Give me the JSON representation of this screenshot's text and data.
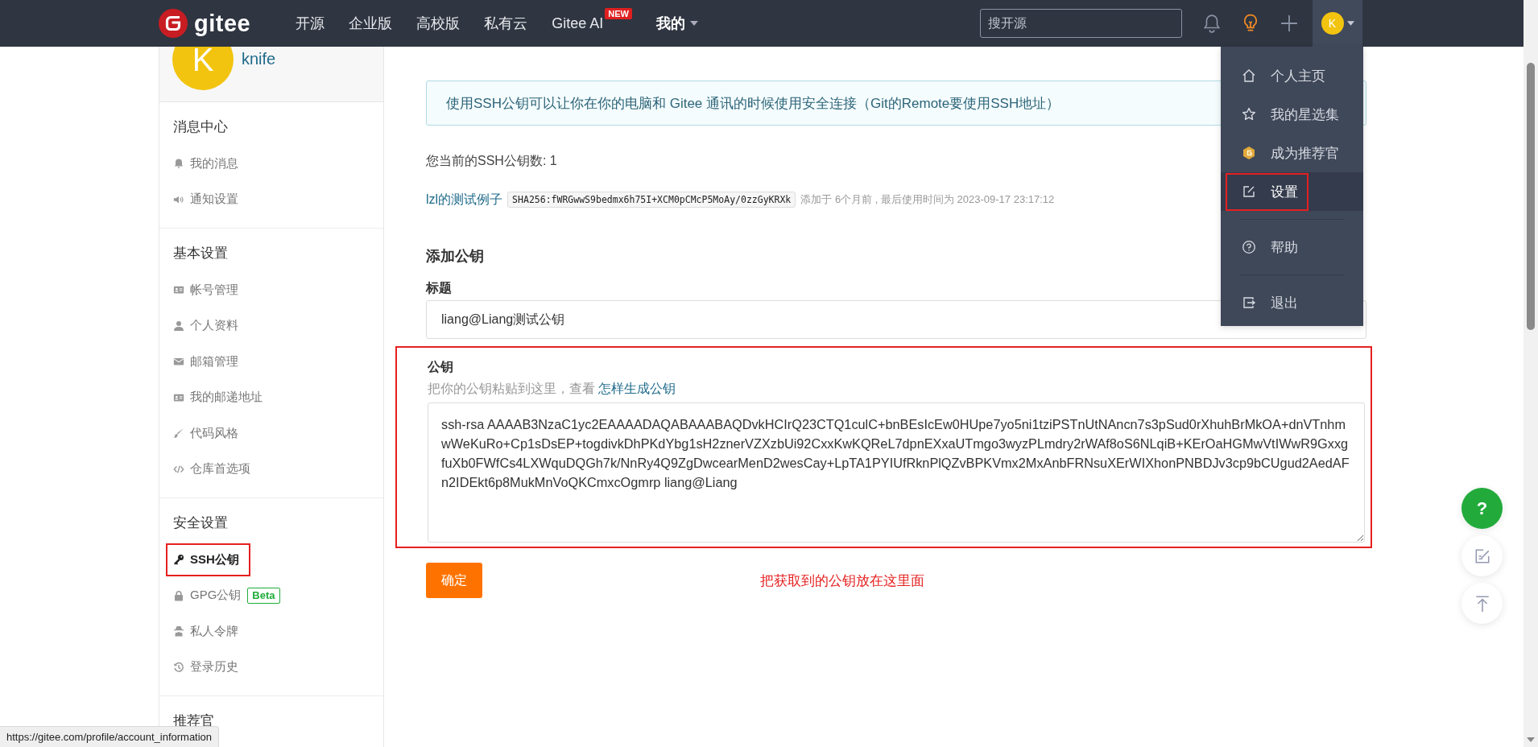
{
  "topbar": {
    "logo": "gitee",
    "nav": [
      {
        "label": "开源",
        "caret": false
      },
      {
        "label": "企业版",
        "caret": false
      },
      {
        "label": "高校版",
        "caret": false
      },
      {
        "label": "私有云",
        "caret": false
      },
      {
        "label": "Gitee AI",
        "badge": "NEW",
        "caret": false
      },
      {
        "label": "我的",
        "caret": true
      }
    ],
    "search": {
      "placeholder": "搜开源"
    },
    "avatar": "K"
  },
  "sidebar": {
    "user": {
      "avatar": "K",
      "name": "knife"
    },
    "sections": [
      {
        "title": "消息中心",
        "items": [
          {
            "label": "我的消息",
            "selected": false,
            "highlighted": false
          },
          {
            "label": "通知设置",
            "selected": false,
            "highlighted": false
          }
        ]
      },
      {
        "title": "基本设置",
        "items": [
          {
            "label": "帐号管理",
            "selected": false,
            "highlighted": false
          },
          {
            "label": "个人资料",
            "selected": false,
            "highlighted": false
          },
          {
            "label": "邮箱管理",
            "selected": false,
            "highlighted": false
          },
          {
            "label": "我的邮递地址",
            "selected": false,
            "highlighted": false
          },
          {
            "label": "代码风格",
            "selected": false,
            "highlighted": false
          },
          {
            "label": "仓库首选项",
            "selected": false,
            "highlighted": false
          }
        ]
      },
      {
        "title": "安全设置",
        "items": [
          {
            "label": "SSH公钥",
            "selected": true,
            "highlighted": true
          },
          {
            "label": "GPG公钥",
            "badge": "Beta",
            "selected": false,
            "highlighted": false
          },
          {
            "label": "私人令牌",
            "selected": false,
            "highlighted": false
          },
          {
            "label": "登录历史",
            "selected": false,
            "highlighted": false
          }
        ]
      },
      {
        "title": "推荐官"
      }
    ]
  },
  "main": {
    "info": "使用SSH公钥可以让你在你的电脑和 Gitee 通讯的时候使用安全连接（Git的Remote要使用SSH地址）",
    "count": "您当前的SSH公钥数: 1",
    "keys": [
      {
        "name": "lzl的测试例子",
        "fingerprint": "SHA256:fWRGwwS9bedmx6h75I+XCM0pCMcP5MoAy/0zzGyKRXk",
        "meta": "添加于 6个月前 , 最后使用时间为 2023-09-17 23:17:12"
      }
    ],
    "form": {
      "heading": "添加公钥",
      "title_label": "标题",
      "title_value": "liang@Liang测试公钥",
      "key_label": "公钥",
      "hint": "把你的公钥粘贴到这里，查看",
      "hint_link": "怎样生成公钥",
      "key_value": "ssh-rsa AAAAB3NzaC1yc2EAAAADAQABAAABAQDvkHCIrQ23CTQ1culC+bnBEsIcEw0HUpe7yo5ni1tziPSTnUtNAncn7s3pSud0rXhuhBrMkOA+dnVTnhmwWeKuRo+Cp1sDsEP+togdivkDhPKdYbg1sH2znerVZXzbUi92CxxKwKQReL7dpnEXxaUTmgo3wyzPLmdry2rWAf8oS6NLqiB+KErOaHGMwVtIWwR9GxxgfuXb0FWfCs4LXWquDQGh7k/NnRy4Q9ZgDwcearMenD2wesCay+LpTA1PYIUfRknPlQZvBPKVmx2MxAnbFRNsuXErWIXhonPNBDJv3cp9bCUgud2AedAFn2IDEkt6p8MukMnVoQKCmxcOgmrp liang@Liang",
      "key_highlighted": true,
      "submit": "确定",
      "note": "把获取到的公钥放在这里面"
    }
  },
  "user_menu": {
    "items": [
      {
        "label": "个人主页",
        "selected": false,
        "highlighted": false,
        "divider_before": false
      },
      {
        "label": "我的星选集",
        "selected": false,
        "highlighted": false,
        "divider_before": false
      },
      {
        "label": "成为推荐官",
        "selected": false,
        "highlighted": false,
        "divider_before": false
      },
      {
        "label": "设置",
        "selected": true,
        "highlighted": true,
        "divider_before": false
      },
      {
        "label": "帮助",
        "selected": false,
        "highlighted": false,
        "divider_before": true
      },
      {
        "label": "退出",
        "selected": false,
        "highlighted": false,
        "divider_before": true
      }
    ]
  },
  "float_buttons": {
    "help": "?"
  },
  "status_bar": {
    "url": "https://gitee.com/profile/account_information"
  }
}
